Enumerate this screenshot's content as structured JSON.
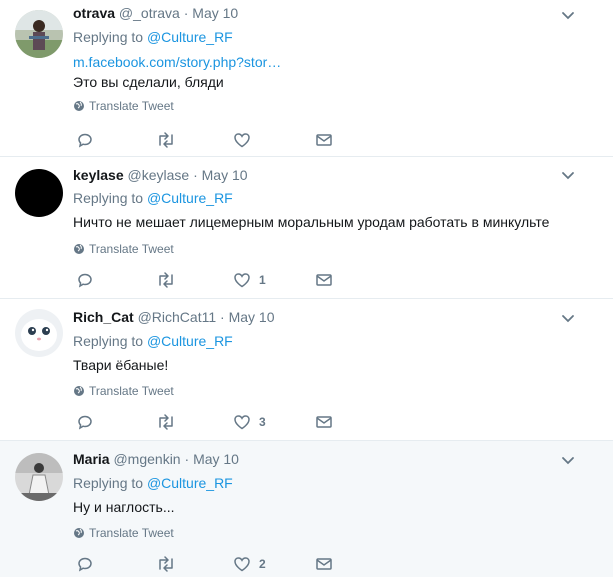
{
  "tweets": [
    {
      "name": "otrava",
      "handle": "@_otrava",
      "separator": "·",
      "date": "May 10",
      "replying_prefix": "Replying to",
      "replying_to": "@Culture_RF",
      "link": "m.facebook.com/story.php?stor…",
      "text": "Это вы сделали, бляди",
      "translate": "Translate Tweet",
      "likes": ""
    },
    {
      "name": "keylase",
      "handle": "@keylase",
      "separator": "·",
      "date": "May 10",
      "replying_prefix": "Replying to",
      "replying_to": "@Culture_RF",
      "text": "Ничто не мешает лицемерным моральным уродам работать в минкульте",
      "translate": "Translate Tweet",
      "likes": "1"
    },
    {
      "name": "Rich_Cat",
      "handle": "@RichCat11",
      "separator": "·",
      "date": "May 10",
      "replying_prefix": "Replying to",
      "replying_to": "@Culture_RF",
      "text": "Твари ёбаные!",
      "translate": "Translate Tweet",
      "likes": "3"
    },
    {
      "name": "Maria",
      "handle": "@mgenkin",
      "separator": "·",
      "date": "May 10",
      "replying_prefix": "Replying to",
      "replying_to": "@Culture_RF",
      "text": "Ну и наглость...",
      "translate": "Translate Tweet",
      "likes": "2"
    }
  ],
  "icons": {
    "reply": "reply-icon",
    "retweet": "retweet-icon",
    "like": "heart-icon",
    "message": "envelope-icon",
    "translate": "globe-icon",
    "more": "chevron-down-icon"
  },
  "colors": {
    "link": "#1b95e0",
    "secondary": "#657786",
    "text": "#14171a",
    "hover_bg": "#f5f8fa"
  }
}
